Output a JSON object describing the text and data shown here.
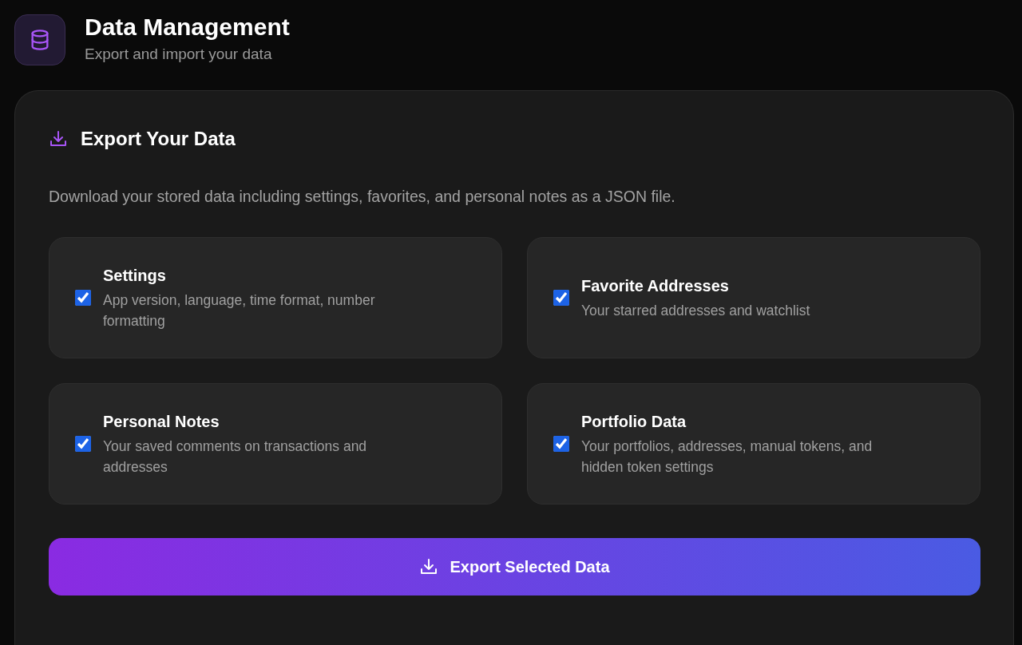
{
  "header": {
    "title": "Data Management",
    "subtitle": "Export and import your data"
  },
  "export": {
    "title": "Export Your Data",
    "description": "Download your stored data including settings, favorites, and personal notes as a JSON file.",
    "options": [
      {
        "label": "Settings",
        "description": "App version, language, time format, number formatting",
        "checked": true
      },
      {
        "label": "Favorite Addresses",
        "description": "Your starred addresses and watchlist",
        "checked": true
      },
      {
        "label": "Personal Notes",
        "description": "Your saved comments on transactions and addresses",
        "checked": true
      },
      {
        "label": "Portfolio Data",
        "description": "Your portfolios, addresses, manual tokens, and hidden token settings",
        "checked": true
      }
    ],
    "button": "Export Selected Data"
  }
}
